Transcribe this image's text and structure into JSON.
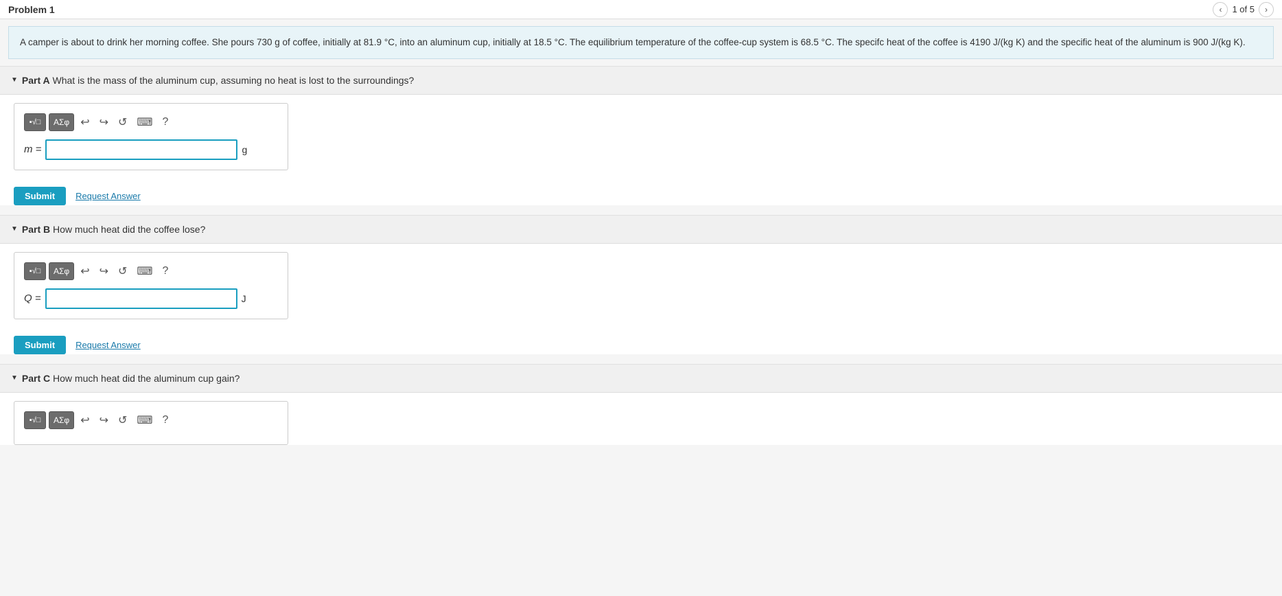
{
  "topBar": {
    "title": "Problem 1",
    "navCount": "1 of 5",
    "prevLabel": "‹",
    "nextLabel": "›"
  },
  "problemDesc": "A camper is about to drink her morning coffee.  She pours 730 g of coffee, initially at 81.9 °C, into an aluminum cup, initially at 18.5 °C.  The equilibrium temperature of the coffee-cup system is 68.5 °C. The specifc heat of the coffee is 4190 J/(kg K) and the specific heat of the aluminum is 900 J/(kg K).",
  "partA": {
    "header": "Part A",
    "question": " What is the mass of the aluminum cup, assuming no heat is lost to the surroundings?",
    "inputLabel": "m =",
    "unit": "g",
    "submitLabel": "Submit",
    "requestLabel": "Request Answer"
  },
  "partB": {
    "header": "Part B",
    "question": " How much heat did the coffee lose?",
    "inputLabel": "Q =",
    "unit": "J",
    "submitLabel": "Submit",
    "requestLabel": "Request Answer"
  },
  "partC": {
    "header": "Part C",
    "question": " How much heat did the aluminum cup gain?"
  },
  "toolbar": {
    "btn1": "▪√□",
    "btn2": "ΑΣφ",
    "undo": "↩",
    "redo": "↪",
    "refresh": "↺",
    "keyboard": "⌨",
    "help": "?"
  }
}
